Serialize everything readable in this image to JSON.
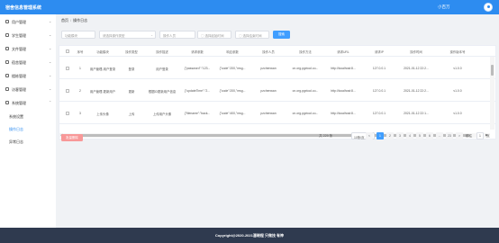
{
  "header": {
    "title": "宿舍信息管理系统",
    "user": "小百万"
  },
  "sidebar": {
    "items": [
      {
        "label": "用户管理",
        "icon": "user-icon"
      },
      {
        "label": "学生管理",
        "icon": "student-icon"
      },
      {
        "label": "文件管理",
        "icon": "folder-icon"
      },
      {
        "label": "宿舍管理",
        "icon": "dorm-icon"
      },
      {
        "label": "楼栋管理",
        "icon": "building-icon"
      },
      {
        "label": "访客管理",
        "icon": "visitor-icon"
      },
      {
        "label": "系统管理",
        "icon": "gear-icon"
      }
    ],
    "subitems": [
      {
        "label": "系统设置",
        "active": false
      },
      {
        "label": "操作日志",
        "active": true
      },
      {
        "label": "异常日志",
        "active": false
      }
    ]
  },
  "breadcrumb": {
    "home": "首页",
    "current": "操作日志"
  },
  "filters": {
    "keyword_placeholder": "功能模块",
    "type_placeholder": "请选择操作类型",
    "operator_placeholder": "操作人员",
    "start_placeholder": "选择起始时间",
    "end_placeholder": "选择结束时间",
    "search_label": "搜索"
  },
  "table": {
    "headers": [
      "序号",
      "功能模块",
      "操作类型",
      "操作描述",
      "请求参数",
      "响应参数",
      "操作人员",
      "操作方法",
      "请求URL",
      "请求IP",
      "操作时间",
      "操作版本号"
    ],
    "rows": [
      [
        "1",
        "用户管理-用户登录",
        "登录",
        "用户登录",
        "{\"password\":\"123...",
        "{\"code\":200,\"msg...",
        "pzchenwan",
        "cn.org.pgxtool.co...",
        "http://localhost:8...",
        "127.0.0.1",
        "2021-01-12 22:2...",
        "v1.0.0"
      ],
      [
        "2",
        "用户管理-更新用户",
        "更新",
        "根据ID更新用户信息",
        "{\"updateTime\":\"2...",
        "{\"code\":200,\"msg...",
        "pzchenwan",
        "cn.org.pgxtool.co...",
        "http://localhost:8...",
        "127.0.0.1",
        "2021-01-12 22:2...",
        "v1.0.0"
      ],
      [
        "3",
        "上传头像",
        "上传",
        "上传用户头像",
        "{\"filename\":\"back...",
        "{\"code\":400,\"msg...",
        "pzchenwan",
        "cn.org.pgxtool.co...",
        "http://localhost:8...",
        "127.0.0.1",
        "2021-01-12 22:1...",
        "v1.0.0"
      ]
    ]
  },
  "bulk_delete_label": "批量删除",
  "pager": {
    "total": "共 229 条",
    "size": "10条/页",
    "prev": "<",
    "pages": [
      "1",
      "2",
      "3",
      "4",
      "5",
      "6",
      "...",
      "23"
    ],
    "next": ">",
    "goto": "前往",
    "current": "1",
    "page_unit": "页"
  },
  "footer": {
    "copyright": "Copyright@2020-2021潘晓程 只做技 有神"
  }
}
